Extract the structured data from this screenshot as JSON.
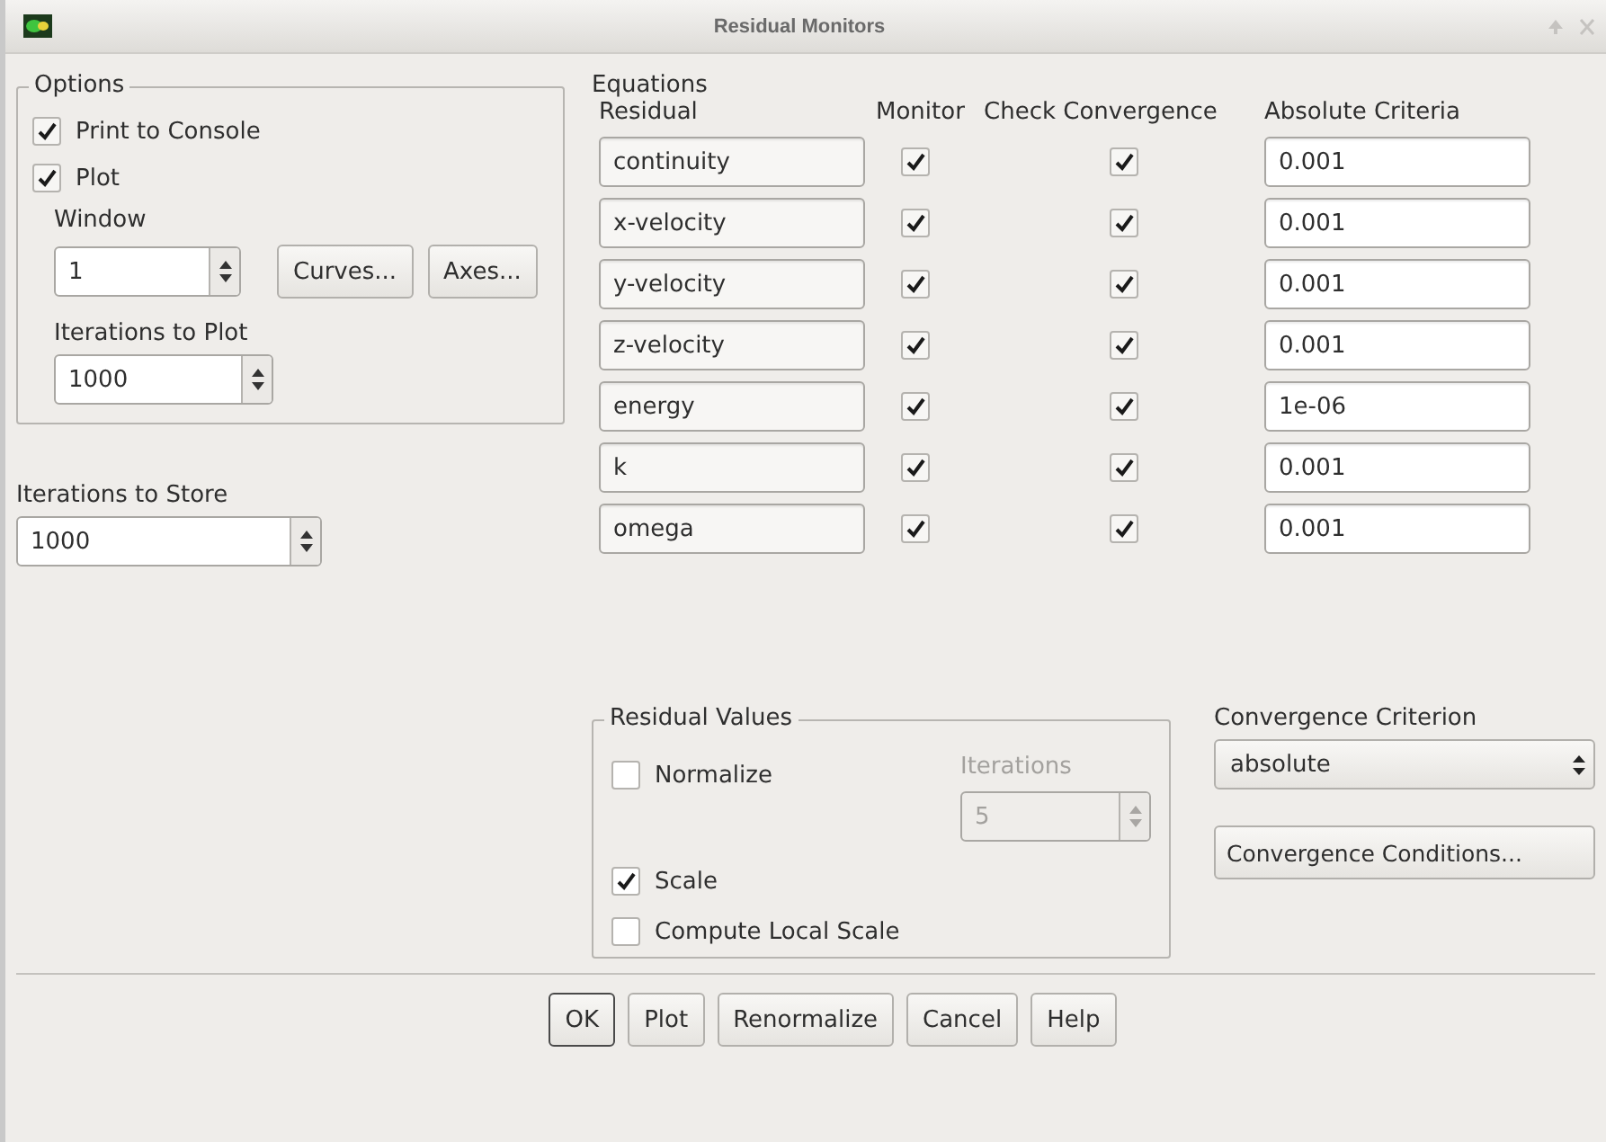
{
  "window": {
    "title": "Residual Monitors"
  },
  "options": {
    "title": "Options",
    "print_to_console": {
      "label": "Print to Console",
      "checked": true
    },
    "plot": {
      "label": "Plot",
      "checked": true
    },
    "window_label": "Window",
    "window_value": "1",
    "curves_button": "Curves...",
    "axes_button": "Axes...",
    "iterations_to_plot_label": "Iterations to Plot",
    "iterations_to_plot": "1000"
  },
  "iterations_to_store": {
    "label": "Iterations to Store",
    "value": "1000"
  },
  "equations": {
    "title": "Equations",
    "columns": [
      "Residual",
      "Monitor",
      "Check Convergence",
      "Absolute Criteria"
    ],
    "rows": [
      {
        "residual": "continuity",
        "monitor": true,
        "check_convergence": true,
        "absolute_criteria": "0.001"
      },
      {
        "residual": "x-velocity",
        "monitor": true,
        "check_convergence": true,
        "absolute_criteria": "0.001"
      },
      {
        "residual": "y-velocity",
        "monitor": true,
        "check_convergence": true,
        "absolute_criteria": "0.001"
      },
      {
        "residual": "z-velocity",
        "monitor": true,
        "check_convergence": true,
        "absolute_criteria": "0.001"
      },
      {
        "residual": "energy",
        "monitor": true,
        "check_convergence": true,
        "absolute_criteria": "1e-06"
      },
      {
        "residual": "k",
        "monitor": true,
        "check_convergence": true,
        "absolute_criteria": "0.001"
      },
      {
        "residual": "omega",
        "monitor": true,
        "check_convergence": true,
        "absolute_criteria": "0.001"
      }
    ]
  },
  "residual_values": {
    "title": "Residual Values",
    "normalize": {
      "label": "Normalize",
      "checked": false
    },
    "iterations": {
      "label": "Iterations",
      "value": "5",
      "disabled": true
    },
    "scale": {
      "label": "Scale",
      "checked": true
    },
    "compute_local_scale": {
      "label": "Compute Local Scale",
      "checked": false
    }
  },
  "convergence_criterion": {
    "label": "Convergence Criterion",
    "value": "absolute"
  },
  "convergence_conditions_button": "Convergence Conditions...",
  "buttons": [
    {
      "label": "OK",
      "default": true
    },
    {
      "label": "Plot",
      "default": false
    },
    {
      "label": "Renormalize",
      "default": false
    },
    {
      "label": "Cancel",
      "default": false
    },
    {
      "label": "Help",
      "default": false
    }
  ]
}
